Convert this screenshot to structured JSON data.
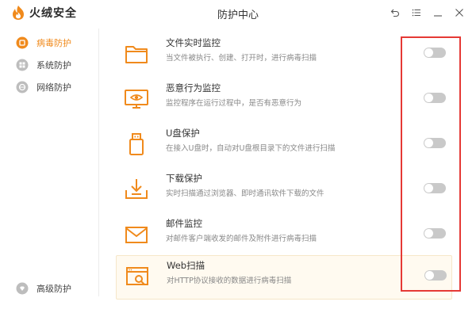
{
  "app": {
    "name": "火绒安全",
    "window_title": "防护中心",
    "brand_color": "#f08a1c",
    "annotation_color": "#e53935"
  },
  "window_controls": [
    {
      "name": "back",
      "icon": "back-arrow-icon"
    },
    {
      "name": "menu",
      "icon": "menu-icon"
    },
    {
      "name": "minimize",
      "icon": "minimize-icon"
    },
    {
      "name": "close",
      "icon": "close-icon"
    }
  ],
  "sidebar": {
    "items": [
      {
        "label": "病毒防护",
        "icon": "virus-shield-icon",
        "active": true
      },
      {
        "label": "系统防护",
        "icon": "system-shield-icon",
        "active": false
      },
      {
        "label": "网络防护",
        "icon": "network-shield-icon",
        "active": false
      }
    ],
    "bottom_item": {
      "label": "高级防护",
      "icon": "advanced-shield-icon"
    }
  },
  "features": [
    {
      "title": "文件实时监控",
      "desc": "当文件被执行、创建、打开时，进行病毒扫描",
      "icon": "folder-icon",
      "enabled": false
    },
    {
      "title": "恶意行为监控",
      "desc": "监控程序在运行过程中，是否有恶意行为",
      "icon": "monitor-eye-icon",
      "enabled": false
    },
    {
      "title": "U盘保护",
      "desc": "在接入U盘时，自动对U盘根目录下的文件进行扫描",
      "icon": "usb-drive-icon",
      "enabled": false
    },
    {
      "title": "下载保护",
      "desc": "实时扫描通过浏览器、即时通讯软件下载的文件",
      "icon": "download-tray-icon",
      "enabled": false
    },
    {
      "title": "邮件监控",
      "desc": "对邮件客户端收发的邮件及附件进行病毒扫描",
      "icon": "mail-icon",
      "enabled": false
    },
    {
      "title": "Web扫描",
      "desc": "对HTTP协议接收的数据进行病毒扫描",
      "icon": "web-scan-icon",
      "enabled": false
    }
  ]
}
